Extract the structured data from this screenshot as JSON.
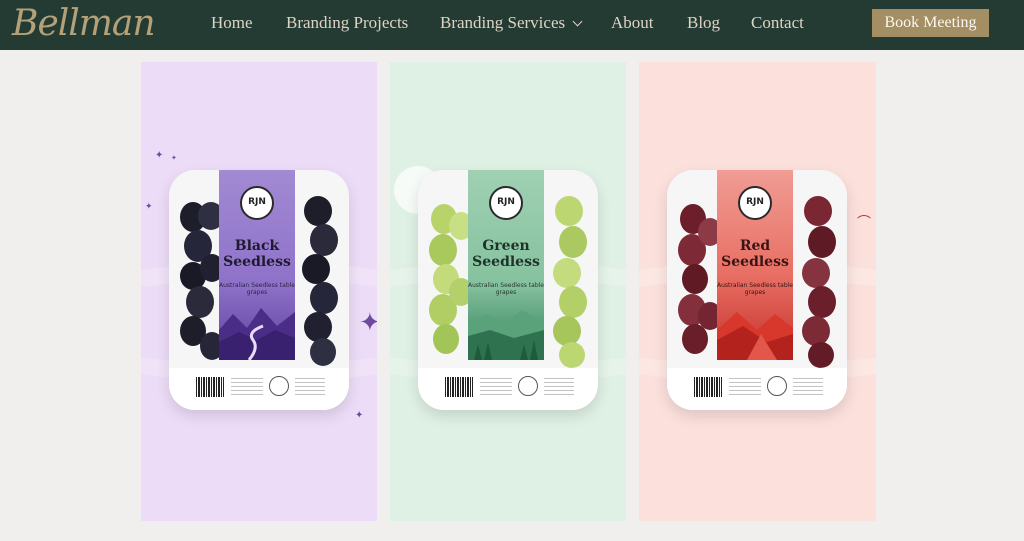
{
  "header": {
    "logo": "Bellman",
    "nav": {
      "home": "Home",
      "projects": "Branding Projects",
      "services": "Branding Services",
      "about": "About",
      "blog": "Blog",
      "contact": "Contact"
    },
    "cta": "Book Meeting"
  },
  "colors": {
    "header_bg": "#243b34",
    "gold": "#a48e63",
    "black_panel": "#ecdcf7",
    "green_panel": "#dff0e4",
    "red_panel": "#fbe0dc"
  },
  "products": [
    {
      "brand": "RJN",
      "name": "Black Seedless",
      "subtitle": "Australian Seedless table grapes"
    },
    {
      "brand": "RJN",
      "name": "Green Seedless",
      "subtitle": "Australian Seedless table grapes"
    },
    {
      "brand": "RJN",
      "name": "Red Seedless",
      "subtitle": "Australian Seedless table grapes"
    }
  ]
}
